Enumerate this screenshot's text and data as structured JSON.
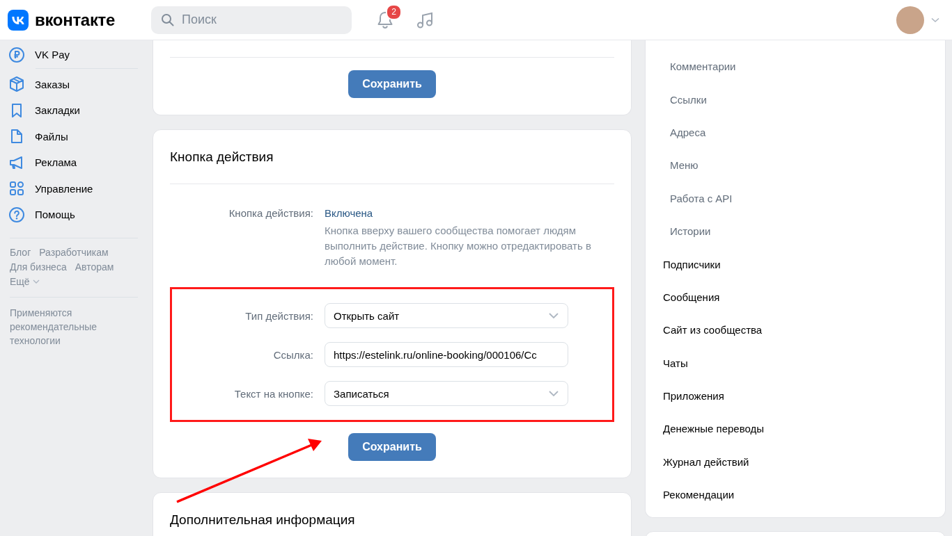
{
  "header": {
    "logo": "вконтакте",
    "search": {
      "placeholder": "Поиск"
    },
    "notifications_badge": "2"
  },
  "sidebar": {
    "items": [
      {
        "label": "VK Pay"
      },
      {
        "label": "Заказы"
      },
      {
        "label": "Закладки"
      },
      {
        "label": "Файлы"
      },
      {
        "label": "Реклама"
      },
      {
        "label": "Управление"
      },
      {
        "label": "Помощь"
      }
    ],
    "links": [
      "Блог",
      "Разработчикам",
      "Для бизнеса",
      "Авторам"
    ],
    "more": "Ещё",
    "note": "Применяются рекомендательные технологии"
  },
  "top_card": {
    "save_button": "Сохранить"
  },
  "action_card": {
    "title": "Кнопка действия",
    "status_label": "Кнопка действия:",
    "status_value": "Включена",
    "description": "Кнопка вверху вашего сообщества помогает людям выполнить действие. Кнопку можно отредактировать в любой момент.",
    "fields": [
      {
        "label": "Тип действия:",
        "kind": "select",
        "value": "Открыть сайт"
      },
      {
        "label": "Ссылка:",
        "kind": "text",
        "value": "https://estelink.ru/online-booking/000106/Cc"
      },
      {
        "label": "Текст на кнопке:",
        "kind": "select",
        "value": "Записаться"
      }
    ],
    "save_button": "Сохранить"
  },
  "info_card": {
    "title": "Дополнительная информация"
  },
  "right_nav": {
    "items": [
      {
        "label": "Комментарии",
        "kind": "sub"
      },
      {
        "label": "Ссылки",
        "kind": "sub"
      },
      {
        "label": "Адреса",
        "kind": "sub"
      },
      {
        "label": "Меню",
        "kind": "sub"
      },
      {
        "label": "Работа с API",
        "kind": "sub"
      },
      {
        "label": "Истории",
        "kind": "sub"
      },
      {
        "label": "Подписчики",
        "kind": "main"
      },
      {
        "label": "Сообщения",
        "kind": "main"
      },
      {
        "label": "Сайт из сообщества",
        "kind": "main"
      },
      {
        "label": "Чаты",
        "kind": "main"
      },
      {
        "label": "Приложения",
        "kind": "main"
      },
      {
        "label": "Денежные переводы",
        "kind": "main"
      },
      {
        "label": "Журнал действий",
        "kind": "main"
      },
      {
        "label": "Рекомендации",
        "kind": "main"
      }
    ]
  }
}
